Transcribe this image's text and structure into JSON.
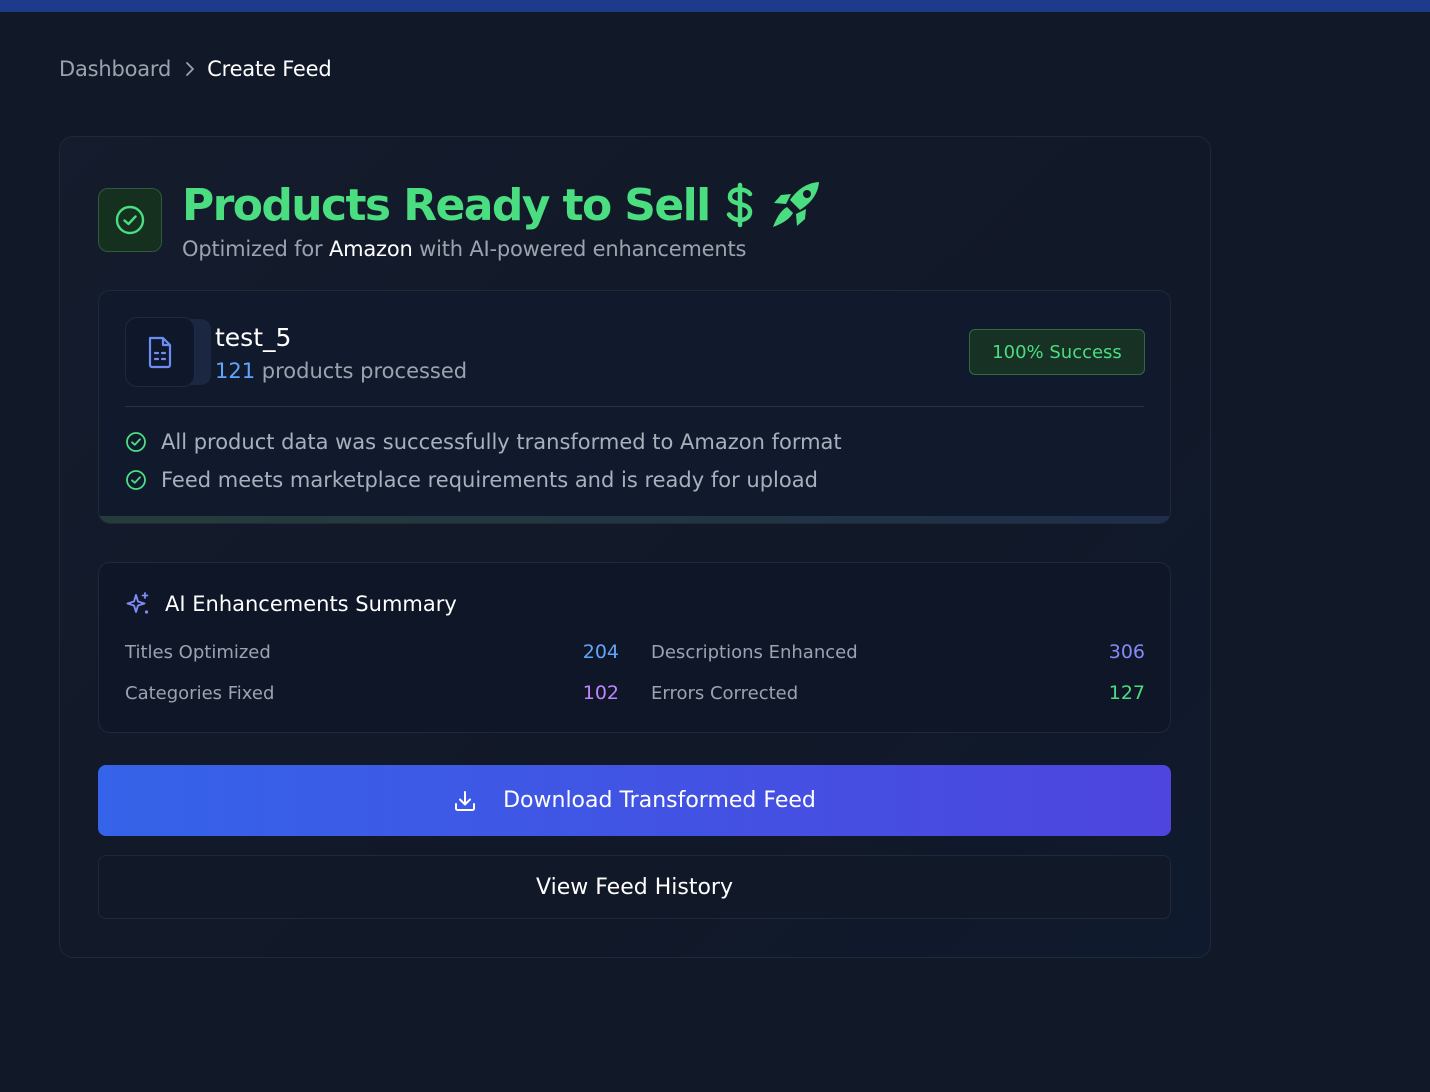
{
  "breadcrumb": {
    "home": "Dashboard",
    "current": "Create Feed"
  },
  "hero": {
    "title": "Products Ready to Sell",
    "subtitle_prefix": "Optimized for",
    "marketplace": "Amazon",
    "subtitle_suffix": "with AI-powered enhancements",
    "icons": [
      "check-circle-icon",
      "dollar-icon",
      "rocket-icon"
    ]
  },
  "feed": {
    "name": "test_5",
    "product_count": "121",
    "count_suffix": "products processed",
    "badge": "100% Success",
    "checks": [
      "All product data was successfully transformed to Amazon format",
      "Feed meets marketplace requirements and is ready for upload"
    ]
  },
  "summary": {
    "title": "AI Enhancements Summary",
    "stats": [
      {
        "label": "Titles Optimized",
        "value": "204",
        "color": "#60a5fa"
      },
      {
        "label": "Descriptions Enhanced",
        "value": "306",
        "color": "#818cf8"
      },
      {
        "label": "Categories Fixed",
        "value": "102",
        "color": "#c084fc"
      },
      {
        "label": "Errors Corrected",
        "value": "127",
        "color": "#4ade80"
      }
    ]
  },
  "actions": {
    "download_label": "Download Transformed Feed",
    "history_label": "View Feed History"
  },
  "colors": {
    "accent_green": "#4ade80",
    "accent_blue": "#3563e9",
    "background": "#111827"
  }
}
